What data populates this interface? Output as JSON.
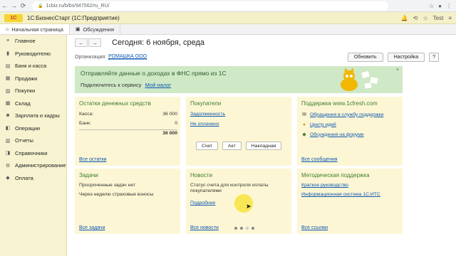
{
  "browser": {
    "url": "1cbiz.ru/b/bs/947562/ru_RU/",
    "user": "Test"
  },
  "app": {
    "title": "1С:БизнесСтарт (1С:Предприятие)"
  },
  "tabs": [
    {
      "label": "Начальная страница"
    },
    {
      "label": "Обсуждения"
    }
  ],
  "sidebar": {
    "items": [
      {
        "label": "Главное",
        "icon": "menu-icon"
      },
      {
        "label": "Руководителю",
        "icon": "chart-icon"
      },
      {
        "label": "Банк и касса",
        "icon": "bank-icon"
      },
      {
        "label": "Продажи",
        "icon": "sales-icon"
      },
      {
        "label": "Покупки",
        "icon": "cart-icon"
      },
      {
        "label": "Склад",
        "icon": "warehouse-icon"
      },
      {
        "label": "Зарплата и кадры",
        "icon": "people-icon"
      },
      {
        "label": "Операции",
        "icon": "operations-icon"
      },
      {
        "label": "Отчеты",
        "icon": "reports-icon"
      },
      {
        "label": "Справочники",
        "icon": "book-icon"
      },
      {
        "label": "Администрирование",
        "icon": "gear-icon"
      },
      {
        "label": "Оплата",
        "icon": "payment-icon"
      }
    ]
  },
  "main": {
    "title": "Сегодня: 6 ноября, среда",
    "org_label": "Организация:",
    "org_value": "РОМАШКА ООО",
    "buttons": {
      "update": "Обновить",
      "settings": "Настройка",
      "help": "?"
    }
  },
  "banner": {
    "title": "Отправляйте данные о доходах в ФНС прямо из 1С",
    "subtitle": "Подключитесь к сервису",
    "link": "Мой налог",
    "close": "×"
  },
  "panels": {
    "cash": {
      "title": "Остатки денежных средств",
      "rows": [
        {
          "label": "Касса:",
          "value": "36 000"
        },
        {
          "label": "Банк:",
          "value": "0"
        }
      ],
      "total": "36 000",
      "footer": "Все остатки"
    },
    "buyers": {
      "title": "Покупатели",
      "links": [
        "Задолженность",
        "Не оплачено"
      ],
      "buttons": [
        "Счет",
        "Акт",
        "Накладная"
      ],
      "footer": "Все сделки"
    },
    "support": {
      "title": "Поддержка www.1cfresh.com",
      "items": [
        {
          "label": "Обращения в службу поддержки",
          "icon": "mail-icon"
        },
        {
          "label": "Центр идей",
          "icon": "lightbulb-icon"
        },
        {
          "label": "Обсуждения на форуме",
          "icon": "forum-icon"
        }
      ],
      "footer": "Все сообщения"
    },
    "tasks": {
      "title": "Задачи",
      "items": [
        {
          "label": "Просроченные задач нет"
        },
        {
          "label": "Через неделю страховые взносы"
        }
      ],
      "footer": "Все задачи"
    },
    "news": {
      "title": "Новости",
      "text": "Статус счета для контроля оплаты покупателями",
      "more": "Подробнее",
      "footer": "Все новости"
    },
    "methodical": {
      "title": "Методическая поддержка",
      "links": [
        "Краткое руководство",
        "Информационная система 1С:ИТС"
      ],
      "footer": "Все ссылки"
    }
  },
  "colors": {
    "sidebar": "#f7f3d0",
    "panel": "#fdf6d4",
    "banner": "#cfe8c6",
    "accent_title": "#3d7d2f",
    "link": "#0b57b3"
  }
}
